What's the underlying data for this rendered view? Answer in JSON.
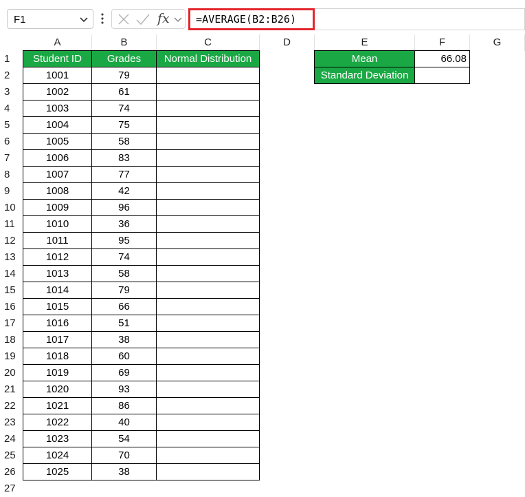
{
  "formula_bar": {
    "name_box": "F1",
    "fx_label": "fx",
    "formula": "=AVERAGE(B2:B26)"
  },
  "columns": [
    "A",
    "B",
    "C",
    "D",
    "E",
    "F",
    "G"
  ],
  "rows": [
    "1",
    "2",
    "3",
    "4",
    "5",
    "6",
    "7",
    "8",
    "9",
    "10",
    "11",
    "12",
    "13",
    "14",
    "15",
    "16",
    "17",
    "18",
    "19",
    "20",
    "21",
    "22",
    "23",
    "24",
    "25",
    "26",
    "27"
  ],
  "table": {
    "headers": [
      "Student ID",
      "Grades",
      "Normal Distribution"
    ],
    "records": [
      [
        "1001",
        "79"
      ],
      [
        "1002",
        "61"
      ],
      [
        "1003",
        "74"
      ],
      [
        "1004",
        "75"
      ],
      [
        "1005",
        "58"
      ],
      [
        "1006",
        "83"
      ],
      [
        "1007",
        "77"
      ],
      [
        "1008",
        "42"
      ],
      [
        "1009",
        "96"
      ],
      [
        "1010",
        "36"
      ],
      [
        "1011",
        "95"
      ],
      [
        "1012",
        "74"
      ],
      [
        "1013",
        "58"
      ],
      [
        "1014",
        "79"
      ],
      [
        "1015",
        "66"
      ],
      [
        "1016",
        "51"
      ],
      [
        "1017",
        "38"
      ],
      [
        "1018",
        "60"
      ],
      [
        "1019",
        "69"
      ],
      [
        "1020",
        "93"
      ],
      [
        "1021",
        "86"
      ],
      [
        "1022",
        "40"
      ],
      [
        "1023",
        "54"
      ],
      [
        "1024",
        "70"
      ],
      [
        "1025",
        "38"
      ]
    ]
  },
  "stats": {
    "mean_label": "Mean",
    "mean_value": "66.08",
    "std_label": "Standard Deviation",
    "std_value": ""
  },
  "colors": {
    "header_green": "#1aa844",
    "highlight_red": "#e3262d"
  }
}
